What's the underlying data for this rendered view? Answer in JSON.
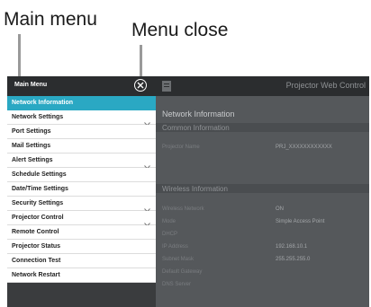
{
  "callouts": {
    "main_menu": "Main menu",
    "menu_close": "Menu close"
  },
  "menu": {
    "title": "Main Menu",
    "items": [
      {
        "label": "Network Information",
        "active": true,
        "has_submenu": false
      },
      {
        "label": "Network Settings",
        "active": false,
        "has_submenu": true
      },
      {
        "label": "Port Settings",
        "active": false,
        "has_submenu": false
      },
      {
        "label": "Mail Settings",
        "active": false,
        "has_submenu": false
      },
      {
        "label": "Alert Settings",
        "active": false,
        "has_submenu": true
      },
      {
        "label": "Schedule Settings",
        "active": false,
        "has_submenu": false
      },
      {
        "label": "Date/Time Settings",
        "active": false,
        "has_submenu": false
      },
      {
        "label": "Security Settings",
        "active": false,
        "has_submenu": true
      },
      {
        "label": "Projector Control",
        "active": false,
        "has_submenu": true
      },
      {
        "label": "Remote Control",
        "active": false,
        "has_submenu": false
      },
      {
        "label": "Projector Status",
        "active": false,
        "has_submenu": false
      },
      {
        "label": "Connection Test",
        "active": false,
        "has_submenu": false
      },
      {
        "label": "Network Restart",
        "active": false,
        "has_submenu": false
      }
    ],
    "icons": {
      "close": "close-circle-icon",
      "chevron": "chevron-down-icon",
      "page": "document-icon"
    }
  },
  "background": {
    "app_title": "Projector Web Control",
    "page_heading": "Network Information",
    "common_section": "Common Information",
    "projector_name_label": "Projector Name",
    "projector_name_value": "PRJ_XXXXXXXXXXXX",
    "wireless_section": "Wireless Information",
    "rows": [
      {
        "label": "Wireless Network",
        "value": "ON"
      },
      {
        "label": "Mode",
        "value": "Simple Access Point"
      },
      {
        "label": "DHCP",
        "value": ""
      },
      {
        "label": "IP Address",
        "value": "192.168.10.1"
      },
      {
        "label": "Subnet Mask",
        "value": "255.255.255.0"
      },
      {
        "label": "Default Gateway",
        "value": ""
      },
      {
        "label": "DNS Server",
        "value": ""
      }
    ]
  },
  "colors": {
    "accent": "#2aa8c3",
    "menu_bg": "#3a3c3e",
    "header_bg": "#2b2d2f"
  }
}
